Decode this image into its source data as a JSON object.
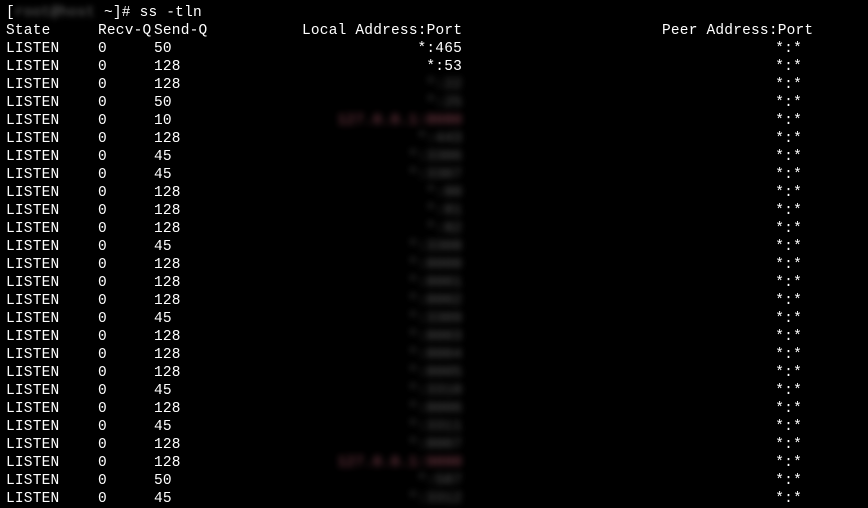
{
  "prompt": {
    "host": "root@host",
    "path": "~",
    "symbol": "]#",
    "command": "ss -tln"
  },
  "headers": {
    "state": "State",
    "recvq": "Recv-Q",
    "sendq": "Send-Q",
    "local": "Local Address:Port",
    "peer": "Peer Address:Port"
  },
  "rows": [
    {
      "state": "LISTEN",
      "recvq": "0",
      "sendq": "50",
      "local": "*:465",
      "peer": "*:*",
      "blurLocal": false,
      "reddish": false
    },
    {
      "state": "LISTEN",
      "recvq": "0",
      "sendq": "128",
      "local": "*:53",
      "peer": "*:*",
      "blurLocal": false,
      "reddish": false
    },
    {
      "state": "LISTEN",
      "recvq": "0",
      "sendq": "128",
      "local": "*:22",
      "peer": "*:*",
      "blurLocal": true,
      "reddish": false
    },
    {
      "state": "LISTEN",
      "recvq": "0",
      "sendq": "50",
      "local": "*:25",
      "peer": "*:*",
      "blurLocal": true,
      "reddish": false
    },
    {
      "state": "LISTEN",
      "recvq": "0",
      "sendq": "10",
      "local": "127.0.0.1:8080",
      "peer": "*:*",
      "blurLocal": true,
      "reddish": true
    },
    {
      "state": "LISTEN",
      "recvq": "0",
      "sendq": "128",
      "local": "*:443",
      "peer": "*:*",
      "blurLocal": true,
      "reddish": false
    },
    {
      "state": "LISTEN",
      "recvq": "0",
      "sendq": "45",
      "local": "*:3306",
      "peer": "*:*",
      "blurLocal": true,
      "reddish": false
    },
    {
      "state": "LISTEN",
      "recvq": "0",
      "sendq": "45",
      "local": "*:3307",
      "peer": "*:*",
      "blurLocal": true,
      "reddish": false
    },
    {
      "state": "LISTEN",
      "recvq": "0",
      "sendq": "128",
      "local": "*:80",
      "peer": "*:*",
      "blurLocal": true,
      "reddish": false
    },
    {
      "state": "LISTEN",
      "recvq": "0",
      "sendq": "128",
      "local": "*:81",
      "peer": "*:*",
      "blurLocal": true,
      "reddish": false
    },
    {
      "state": "LISTEN",
      "recvq": "0",
      "sendq": "128",
      "local": "*:82",
      "peer": "*:*",
      "blurLocal": true,
      "reddish": false
    },
    {
      "state": "LISTEN",
      "recvq": "0",
      "sendq": "45",
      "local": "*:3308",
      "peer": "*:*",
      "blurLocal": true,
      "reddish": false
    },
    {
      "state": "LISTEN",
      "recvq": "0",
      "sendq": "128",
      "local": "*:8000",
      "peer": "*:*",
      "blurLocal": true,
      "reddish": false
    },
    {
      "state": "LISTEN",
      "recvq": "0",
      "sendq": "128",
      "local": "*:8001",
      "peer": "*:*",
      "blurLocal": true,
      "reddish": false
    },
    {
      "state": "LISTEN",
      "recvq": "0",
      "sendq": "128",
      "local": "*:8002",
      "peer": "*:*",
      "blurLocal": true,
      "reddish": false
    },
    {
      "state": "LISTEN",
      "recvq": "0",
      "sendq": "45",
      "local": "*:3309",
      "peer": "*:*",
      "blurLocal": true,
      "reddish": false
    },
    {
      "state": "LISTEN",
      "recvq": "0",
      "sendq": "128",
      "local": "*:8003",
      "peer": "*:*",
      "blurLocal": true,
      "reddish": false
    },
    {
      "state": "LISTEN",
      "recvq": "0",
      "sendq": "128",
      "local": "*:8004",
      "peer": "*:*",
      "blurLocal": true,
      "reddish": false
    },
    {
      "state": "LISTEN",
      "recvq": "0",
      "sendq": "128",
      "local": "*:8005",
      "peer": "*:*",
      "blurLocal": true,
      "reddish": false
    },
    {
      "state": "LISTEN",
      "recvq": "0",
      "sendq": "45",
      "local": "*:3310",
      "peer": "*:*",
      "blurLocal": true,
      "reddish": false
    },
    {
      "state": "LISTEN",
      "recvq": "0",
      "sendq": "128",
      "local": "*:8006",
      "peer": "*:*",
      "blurLocal": true,
      "reddish": false
    },
    {
      "state": "LISTEN",
      "recvq": "0",
      "sendq": "45",
      "local": "*:3311",
      "peer": "*:*",
      "blurLocal": true,
      "reddish": false
    },
    {
      "state": "LISTEN",
      "recvq": "0",
      "sendq": "128",
      "local": "*:8007",
      "peer": "*:*",
      "blurLocal": true,
      "reddish": false
    },
    {
      "state": "LISTEN",
      "recvq": "0",
      "sendq": "128",
      "local": "127.0.0.1:9000",
      "peer": "*:*",
      "blurLocal": true,
      "reddish": true
    },
    {
      "state": "LISTEN",
      "recvq": "0",
      "sendq": "50",
      "local": "*:587",
      "peer": "*:*",
      "blurLocal": true,
      "reddish": false
    },
    {
      "state": "LISTEN",
      "recvq": "0",
      "sendq": "45",
      "local": "*:3312",
      "peer": "*:*",
      "blurLocal": true,
      "reddish": false
    }
  ]
}
